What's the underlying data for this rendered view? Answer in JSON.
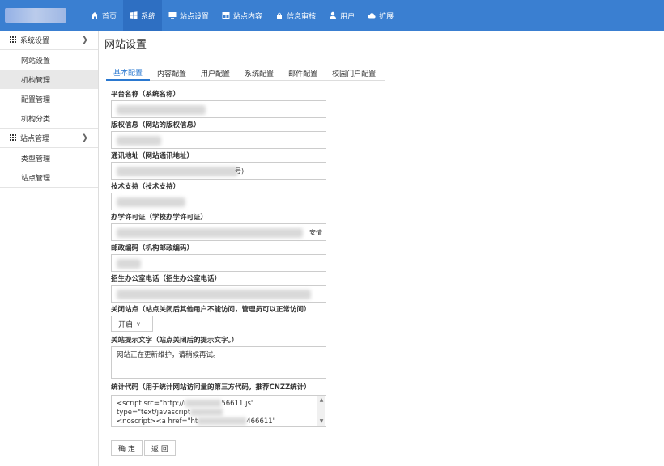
{
  "header": {
    "nav": [
      {
        "label": "首页",
        "icon": "home-icon"
      },
      {
        "label": "系统",
        "icon": "windows-icon"
      },
      {
        "label": "站点设置",
        "icon": "monitor-icon"
      },
      {
        "label": "站点内容",
        "icon": "table-icon"
      },
      {
        "label": "信息审核",
        "icon": "lock-icon"
      },
      {
        "label": "用户",
        "icon": "user-icon"
      },
      {
        "label": "扩展",
        "icon": "cloud-icon"
      }
    ]
  },
  "sidebar": {
    "group1": "系统设置",
    "group1_items": [
      "网站设置",
      "机构管理",
      "配置管理",
      "机构分类"
    ],
    "group2": "站点管理",
    "group2_items": [
      "类型管理",
      "站点管理"
    ]
  },
  "page": {
    "title": "网站设置",
    "tabs": [
      "基本配置",
      "内容配置",
      "用户配置",
      "系统配置",
      "邮件配置",
      "校园门户配置"
    ]
  },
  "form": {
    "platform_name_label": "平台名称（系统名称）",
    "copyright_label": "版权信息（网站的版权信息）",
    "address_label": "通讯地址（网站通讯地址）",
    "address_tail": "号)",
    "support_label": "技术支持（技术支持）",
    "license_label": "办学许可证（学校办学许可证）",
    "license_tail": "安情",
    "postcode_label": "邮政编码（机构邮政编码）",
    "phone_label": "招生办公室电话（招生办公室电话）",
    "close_site_label": "关闭站点（站点关闭后其他用户不能访问，管理员可以正常访问）",
    "close_site_value": "开启",
    "close_notice_label": "关站提示文字（站点关闭后的提示文字。）",
    "close_notice_value": "网站正在更新维护，请稍候再试。",
    "stats_label": "统计代码（用于统计网站访问量的第三方代码，推荐CNZZ统计）",
    "stats_line1": "<script src=\"http://i",
    "stats_line1_tail": "56611.js\"",
    "stats_line2": "type=\"text/javascript",
    "stats_line3": "<noscript><a href=\"ht",
    "stats_line3_tail": "466611\""
  },
  "actions": {
    "confirm": "确 定",
    "back": "返 回"
  }
}
